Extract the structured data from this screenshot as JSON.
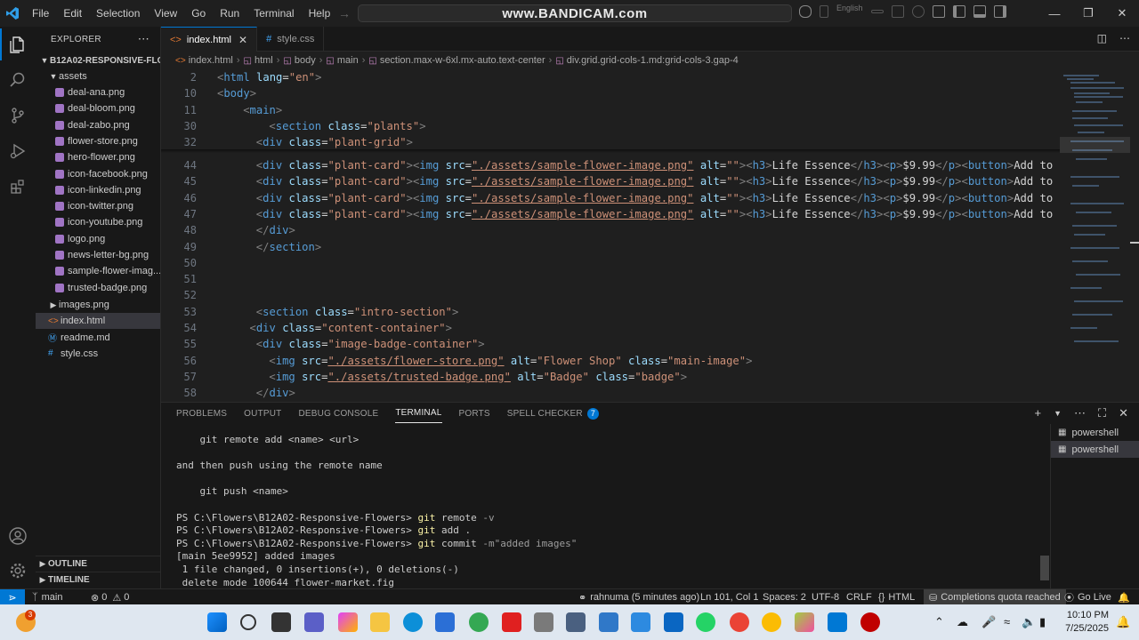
{
  "titlebar": {
    "menu": [
      "File",
      "Edit",
      "Selection",
      "View",
      "Go",
      "Run",
      "Terminal",
      "Help"
    ],
    "command_center": "www.BANDICAM.com",
    "language": "English"
  },
  "sidebar": {
    "title": "EXPLORER",
    "project": "B12A02-RESPONSIVE-FLO...",
    "folder_assets": "assets",
    "files": [
      {
        "name": "deal-ana.png",
        "type": "png"
      },
      {
        "name": "deal-bloom.png",
        "type": "png"
      },
      {
        "name": "deal-zabo.png",
        "type": "png"
      },
      {
        "name": "flower-store.png",
        "type": "png"
      },
      {
        "name": "hero-flower.png",
        "type": "png"
      },
      {
        "name": "icon-facebook.png",
        "type": "png"
      },
      {
        "name": "icon-linkedin.png",
        "type": "png"
      },
      {
        "name": "icon-twitter.png",
        "type": "png"
      },
      {
        "name": "icon-youtube.png",
        "type": "png"
      },
      {
        "name": "logo.png",
        "type": "png"
      },
      {
        "name": "news-letter-bg.png",
        "type": "png"
      },
      {
        "name": "sample-flower-imag...",
        "type": "png"
      },
      {
        "name": "trusted-badge.png",
        "type": "png"
      }
    ],
    "root_items": [
      {
        "name": "images.png",
        "type": "folder"
      },
      {
        "name": "index.html",
        "type": "html"
      },
      {
        "name": "readme.md",
        "type": "md"
      },
      {
        "name": "style.css",
        "type": "css"
      }
    ],
    "outline": "OUTLINE",
    "timeline": "TIMELINE"
  },
  "tabs": [
    {
      "label": "index.html",
      "active": true
    },
    {
      "label": "style.css",
      "active": false
    }
  ],
  "breadcrumb": [
    "index.html",
    "html",
    "body",
    "main",
    "section.max-w-6xl.mx-auto.text-center",
    "div.grid.grid-cols-1.md:grid-cols-3.gap-4"
  ],
  "editor": {
    "sticky_lines": [
      {
        "num": "2",
        "code": "<html lang=\"en\">"
      },
      {
        "num": "10",
        "code": "<body>"
      },
      {
        "num": "11",
        "code": "<main>"
      },
      {
        "num": "30",
        "code": "<section class=\"plants\">"
      },
      {
        "num": "32",
        "code": "<div class=\"plant-grid\">"
      }
    ],
    "lines": [
      {
        "num": "44",
        "code": "<div class=\"plant-card\"><img src=\"./assets/sample-flower-image.png\" alt=\"\"><h3>Life Essence</h3><p>$9.99</p><button>Add to"
      },
      {
        "num": "45",
        "code": "<div class=\"plant-card\"><img src=\"./assets/sample-flower-image.png\" alt=\"\"><h3>Life Essence</h3><p>$9.99</p><button>Add to"
      },
      {
        "num": "46",
        "code": "<div class=\"plant-card\"><img src=\"./assets/sample-flower-image.png\" alt=\"\"><h3>Life Essence</h3><p>$9.99</p><button>Add to"
      },
      {
        "num": "47",
        "code": "<div class=\"plant-card\"><img src=\"./assets/sample-flower-image.png\" alt=\"\"><h3>Life Essence</h3><p>$9.99</p><button>Add to"
      },
      {
        "num": "48",
        "code": "</div>"
      },
      {
        "num": "49",
        "code": "</section>"
      },
      {
        "num": "50",
        "code": ""
      },
      {
        "num": "51",
        "code": ""
      },
      {
        "num": "52",
        "code": ""
      },
      {
        "num": "53",
        "code": "<section class=\"intro-section\">"
      },
      {
        "num": "54",
        "code": "<div class=\"content-container\">"
      },
      {
        "num": "55",
        "code": "<div class=\"image-badge-container\">"
      },
      {
        "num": "56",
        "code": "<img src=\"./assets/flower-store.png\" alt=\"Flower Shop\" class=\"main-image\">"
      },
      {
        "num": "57",
        "code": "<img src=\"./assets/trusted-badge.png\" alt=\"Badge\" class=\"badge\">"
      },
      {
        "num": "58",
        "code": "</div>"
      }
    ]
  },
  "panel": {
    "tabs": [
      "PROBLEMS",
      "OUTPUT",
      "DEBUG CONSOLE",
      "TERMINAL",
      "PORTS",
      "SPELL CHECKER"
    ],
    "active_tab": "TERMINAL",
    "spell_count": "7",
    "terminal_lines": [
      {
        "text": "    git remote add <name> <url>",
        "kind": "plain"
      },
      {
        "text": "",
        "kind": "plain"
      },
      {
        "text": "and then push using the remote name",
        "kind": "plain"
      },
      {
        "text": "",
        "kind": "plain"
      },
      {
        "text": "    git push <name>",
        "kind": "plain"
      },
      {
        "text": "",
        "kind": "plain"
      },
      {
        "prompt": "PS C:\\Flowers\\B12A02-Responsive-Flowers> ",
        "cmd": "git",
        "args": " remote ",
        "flag": "-v",
        "kind": "cmd"
      },
      {
        "prompt": "PS C:\\Flowers\\B12A02-Responsive-Flowers> ",
        "cmd": "git",
        "args": " add .",
        "flag": "",
        "kind": "cmd"
      },
      {
        "prompt": "PS C:\\Flowers\\B12A02-Responsive-Flowers> ",
        "cmd": "git",
        "args": " commit ",
        "flag": "-m\"added images\"",
        "kind": "cmd"
      },
      {
        "text": "[main 5ee9952] added images",
        "kind": "plain"
      },
      {
        "text": " 1 file changed, 0 insertions(+), 0 deletions(-)",
        "kind": "plain"
      },
      {
        "text": " delete mode 100644 flower-market.fig",
        "kind": "plain"
      }
    ],
    "terminals": [
      "powershell",
      "powershell"
    ]
  },
  "statusbar": {
    "branch": "main",
    "errors": "0",
    "warnings": "0",
    "blame": "rahnuma (5 minutes ago)",
    "position": "Ln 101, Col 1",
    "spaces": "Spaces: 2",
    "encoding": "UTF-8",
    "eol": "CRLF",
    "language": "HTML",
    "quota": "Completions quota reached",
    "golive": "Go Live"
  },
  "taskbar": {
    "time": "10:10 PM",
    "date": "7/25/2025",
    "notification_badge": "3"
  },
  "colors": {
    "accent": "#0078d4",
    "tag": "#569cd6",
    "attr": "#9cdcfe",
    "string": "#ce9178"
  }
}
